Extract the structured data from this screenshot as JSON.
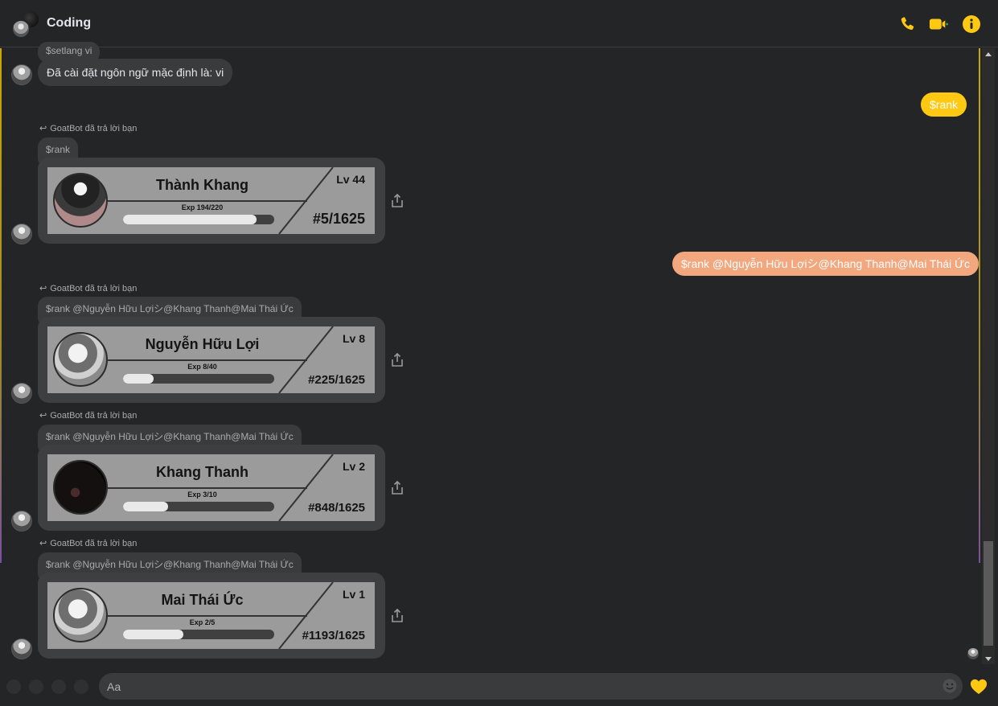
{
  "header": {
    "title": "Coding",
    "icons": [
      "phone-icon",
      "video-call-icon",
      "info-icon"
    ]
  },
  "colors": {
    "accent": "#ffc812",
    "outgoing_bubble_primary": "#ffc812",
    "outgoing_bubble_secondary": "#f2a77f",
    "background": "#242526",
    "incoming_bubble": "#3a3b3c",
    "card": "#9b9b9b"
  },
  "messages": {
    "m1": {
      "quote": "$setlang vi",
      "text": "Đã cài đặt ngôn ngữ mặc định là: vi"
    },
    "m2": {
      "text": "$rank"
    },
    "m3": {
      "replied_label": "GoatBot đã trả lời bạn",
      "quote": "$rank"
    },
    "m4": {
      "text": "$rank @Nguyễn Hữu Lợiシ@Khang Thanh@Mai Thái Ức"
    },
    "m5": {
      "replied_label": "GoatBot đã trả lời bạn",
      "quote": "$rank @Nguyễn Hữu Lợiシ@Khang Thanh@Mai Thái Ức"
    },
    "m6": {
      "replied_label": "GoatBot đã trả lời bạn",
      "quote": "$rank @Nguyễn Hữu Lợiシ@Khang Thanh@Mai Thái Ức"
    },
    "m7": {
      "replied_label": "GoatBot đã trả lời bạn",
      "quote": "$rank @Nguyễn Hữu Lợiシ@Khang Thanh@Mai Thái Ức"
    }
  },
  "rank_cards": [
    {
      "name": "Thành Khang",
      "level": "Lv 44",
      "exp": "Exp 194/220",
      "exp_fraction": 0.882,
      "rank": "#5/1625"
    },
    {
      "name": "Nguyễn Hữu Lợi",
      "level": "Lv 8",
      "exp": "Exp 8/40",
      "exp_fraction": 0.2,
      "rank": "#225/1625"
    },
    {
      "name": "Khang Thanh",
      "level": "Lv 2",
      "exp": "Exp 3/10",
      "exp_fraction": 0.3,
      "rank": "#848/1625"
    },
    {
      "name": "Mai Thái Ức",
      "level": "Lv 1",
      "exp": "Exp 2/5",
      "exp_fraction": 0.4,
      "rank": "#1193/1625"
    }
  ],
  "composer": {
    "placeholder": "Aa",
    "send_icon": "yellow-heart-icon"
  }
}
